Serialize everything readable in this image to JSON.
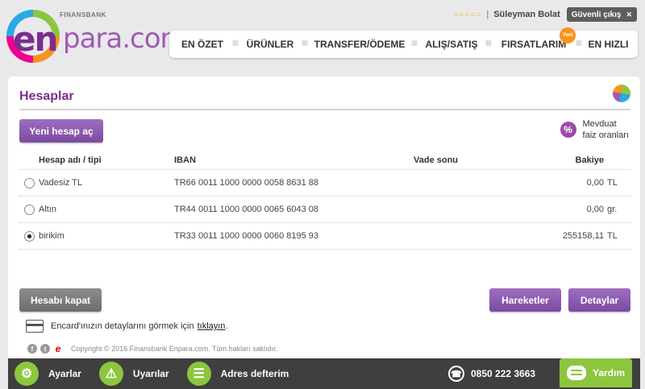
{
  "brand": {
    "logo_en": "en",
    "logo_para": "para.com",
    "bank": "FINANSBANK"
  },
  "user": {
    "stars": "○○○○○",
    "separator": "|",
    "name": "Süleyman Bolat",
    "logout_label": "Güvenli çıkış"
  },
  "nav": [
    {
      "label": "EN ÖZET"
    },
    {
      "label": "ÜRÜNLER"
    },
    {
      "label": "TRANSFER/ÖDEME"
    },
    {
      "label": "ALIŞ/SATIŞ"
    },
    {
      "label": "FIRSATLARIM",
      "badge": "Yeni"
    },
    {
      "label": "EN HIZLI"
    }
  ],
  "page": {
    "title": "Hesaplar",
    "new_account_label": "Yeni hesap aç",
    "rates_line1": "Mevduat",
    "rates_line2": "faiz oranları"
  },
  "table": {
    "headers": {
      "name": "Hesap adı / tipi",
      "iban": "IBAN",
      "vade": "Vade sonu",
      "balance": "Bakiye"
    },
    "rows": [
      {
        "name": "Vadesiz TL",
        "iban": "TR66 0011 1000 0000 0058 8631 88",
        "vade": "",
        "balance": "0,00",
        "currency": "TL",
        "selected": false
      },
      {
        "name": "Altın",
        "iban": "TR44 0011 1000 0000 0065 6043 08",
        "vade": "",
        "balance": "0,00",
        "currency": "gr.",
        "selected": false
      },
      {
        "name": "birikim",
        "iban": "TR33 0011 1000 0000 0060 8195 93",
        "vade": "",
        "balance": "255158,11",
        "currency": "TL",
        "selected": true
      }
    ]
  },
  "actions": {
    "close_label": "Hesabı kapat",
    "movements_label": "Hareketler",
    "details_label": "Detaylar"
  },
  "encard": {
    "text": "Encard'ınızın detaylarını görmek için",
    "link": "tıklayın",
    "suffix": "."
  },
  "footer": {
    "copyright": "Copyright © 2016 Finansbank Enpara.com. Tüm hakları saklıdır."
  },
  "bottombar": {
    "settings_label": "Ayarlar",
    "alerts_label": "Uyarılar",
    "addressbook_label": "Adres defterim",
    "phone": "0850 222 3663",
    "help_label": "Yardım"
  },
  "colors": {
    "accent": "#7b2d8e",
    "button_purple": "#8a5bb0",
    "green": "#8cc63f",
    "bottom_bar": "#3f3f3f"
  }
}
